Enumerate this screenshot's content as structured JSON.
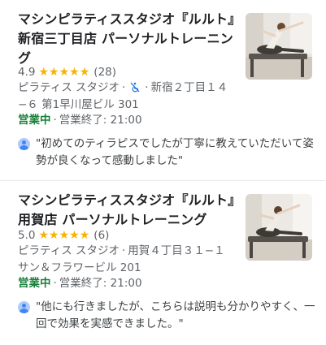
{
  "listings": [
    {
      "title": "マシンピラティススタジオ『ルルト』新宿三丁目店 パーソナルトレーニング",
      "rating": "4.9",
      "stars": [
        "★",
        "★",
        "★",
        "★",
        "★"
      ],
      "review_count": "(28)",
      "category": "ピラティス スタジオ",
      "address": "新宿２丁目１４−６ 第1早川屋ビル 301",
      "status": "営業中",
      "hours": "営業終了: 21:00",
      "review": "\"初めてのティラピスでしたが丁寧に教えていただいて姿勢が良くなって感動しました\"",
      "icons": {
        "accessibility": "not-wheelchair-accessible-icon",
        "reviewer": "reviewer-avatar-icon"
      }
    },
    {
      "title": "マシンピラティススタジオ『ルルト』用賀店 パーソナルトレーニング",
      "rating": "5.0",
      "stars": [
        "★",
        "★",
        "★",
        "★",
        "★"
      ],
      "review_count": "(6)",
      "category": "ピラティス スタジオ",
      "address": "用賀４丁目３１−１ サン＆フラワービル 201",
      "status": "営業中",
      "hours": "営業終了: 21:00",
      "review": "\"他にも行きましたが、こちらは説明も分かりやすく、一回で効果を実感できました。\"",
      "icons": {
        "reviewer": "reviewer-avatar-icon"
      }
    }
  ],
  "colors": {
    "star": "#f6b400",
    "open_status": "#188038",
    "secondary_text": "#5f6368",
    "title_text": "#202124",
    "divider": "#e8eaed",
    "avatar": "#4285f4"
  },
  "separator": "·"
}
